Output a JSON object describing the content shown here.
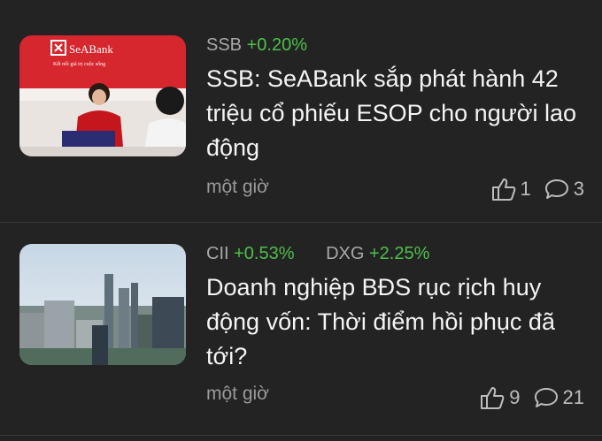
{
  "articles": [
    {
      "tickers": [
        {
          "symbol": "SSB",
          "change": "+0.20%"
        }
      ],
      "thumbnail": {
        "brand": "SeABank",
        "tagline": "Kết nối giá trị cuộc sống"
      },
      "title": "SSB: SeABank sắp phát hành 42 triệu cổ phiếu ESOP cho người lao động",
      "time": "một giờ",
      "likes": "1",
      "comments": "3"
    },
    {
      "tickers": [
        {
          "symbol": "CII",
          "change": "+0.53%"
        },
        {
          "symbol": "DXG",
          "change": "+2.25%"
        }
      ],
      "title": "Doanh nghiệp BĐS rục rịch huy động vốn: Thời điểm hồi phục đã tới?",
      "time": "một giờ",
      "likes": "9",
      "comments": "21"
    }
  ],
  "colors": {
    "background": "#232323",
    "positive": "#4cc04a",
    "muted": "#9a9a9a"
  },
  "icons": {
    "like": "thumbs-up-icon",
    "comment": "comment-bubble-icon"
  }
}
